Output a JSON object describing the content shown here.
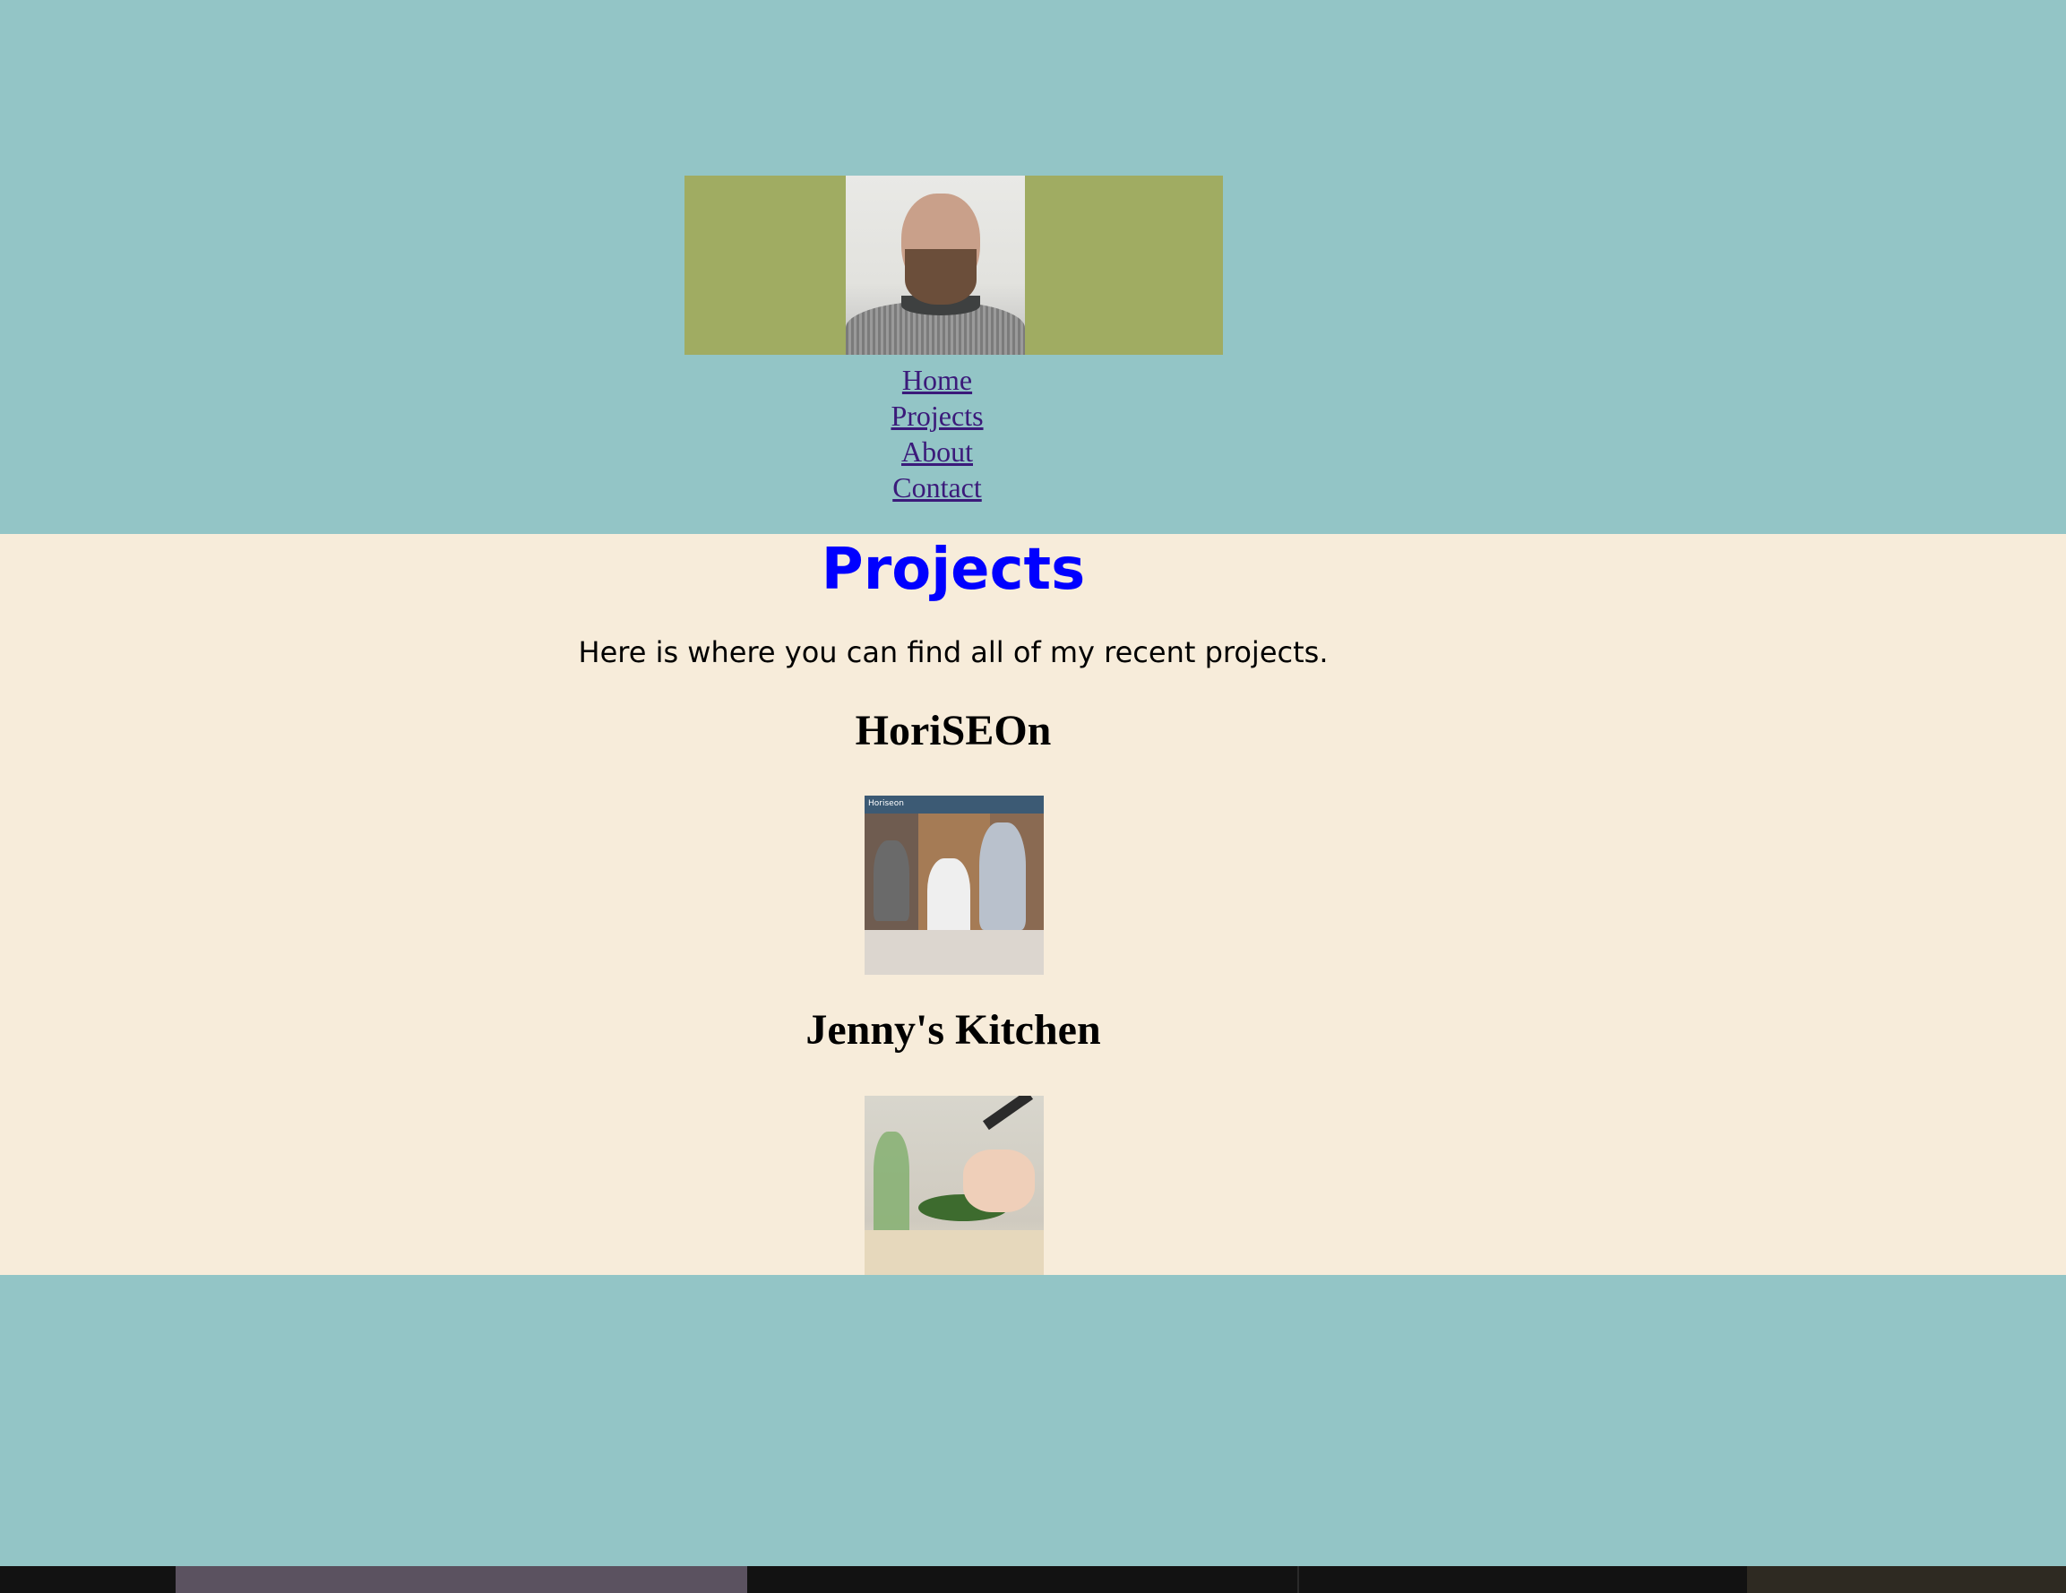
{
  "nav": {
    "items": [
      "Home",
      "Projects",
      "About",
      "Contact"
    ]
  },
  "main": {
    "title": "Projects",
    "intro": "Here is where you can find all of my recent projects.",
    "projects": [
      {
        "title": "HoriSEOn",
        "screenshot_header": "Horiseon"
      },
      {
        "title": "Jenny's Kitchen"
      }
    ]
  },
  "colors": {
    "page_bg": "#93c5c6",
    "main_bg": "#f7ecda",
    "banner_bg": "#a0ac62",
    "heading": "#0000ff",
    "link": "#3b1a7a"
  },
  "icons": {
    "avatar": "profile-photo",
    "project_images": [
      "horiseon-screenshot",
      "kitchen-screenshot"
    ]
  }
}
